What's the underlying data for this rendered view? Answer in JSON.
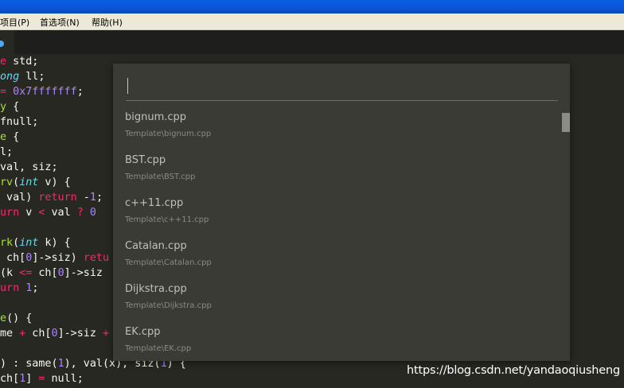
{
  "menu": {
    "items": [
      "项目(P)",
      "首选项(N)",
      "帮助(H)"
    ]
  },
  "code": {
    "lines": [
      "e std;",
      "ong ll;",
      "= 0x7fffffff;",
      "y {",
      "fnull;",
      "e {",
      "l;",
      "val, siz;",
      "rv(int v) {",
      " val) return -1;",
      "urn v < val ? 0",
      "",
      "rk(int k) {",
      " ch[0]->siz) retu",
      "(k <= ch[0]->siz",
      "urn 1;",
      "",
      "e() {",
      "me + ch[0]->siz +",
      "",
      ") : same(1), val(x), siz(1) {",
      "ch[1] = null;"
    ]
  },
  "palette": {
    "query": "",
    "results": [
      {
        "name": "bignum.cpp",
        "path": "Template\\bignum.cpp"
      },
      {
        "name": "BST.cpp",
        "path": "Template\\BST.cpp"
      },
      {
        "name": "c++11.cpp",
        "path": "Template\\c++11.cpp"
      },
      {
        "name": "Catalan.cpp",
        "path": "Template\\Catalan.cpp"
      },
      {
        "name": "Dijkstra.cpp",
        "path": "Template\\Dijkstra.cpp"
      },
      {
        "name": "EK.cpp",
        "path": "Template\\EK.cpp"
      }
    ]
  },
  "watermark": "https://blog.csdn.net/yandaoqiusheng"
}
